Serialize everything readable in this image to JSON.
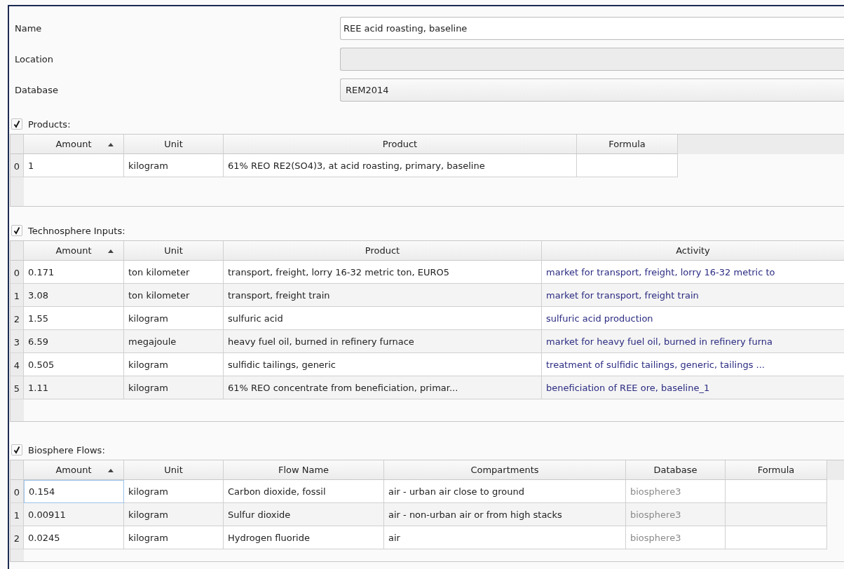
{
  "form": [
    {
      "label": "Name",
      "kind": "text",
      "value": "REE acid roasting, baseline",
      "disabled": false
    },
    {
      "label": "Location",
      "kind": "text",
      "disabled": true
    },
    {
      "label": "Database",
      "kind": "combo",
      "value": "REM2014",
      "disabled": false
    }
  ],
  "sections": [
    {
      "title": "Products:",
      "checked": true,
      "columns": [
        {
          "label": "Amount",
          "sorted_ascending": true,
          "kind": "text"
        },
        {
          "label": "Unit",
          "kind": "text"
        },
        {
          "label": "Product",
          "kind": "text"
        },
        {
          "label": "Formula",
          "kind": "text"
        }
      ],
      "rows": [
        {
          "header": "0",
          "current": false,
          "cells": [
            "1",
            "kilogram",
            "61% REO RE2(SO4)3, at acid roasting, primary, baseline",
            null
          ]
        }
      ]
    },
    {
      "title": "Technosphere Inputs:",
      "checked": true,
      "columns": [
        {
          "label": "Amount",
          "sorted_ascending": true,
          "kind": "text"
        },
        {
          "label": "Unit",
          "kind": "text"
        },
        {
          "label": "Product",
          "kind": "text"
        },
        {
          "label": "Activity",
          "kind": "link"
        }
      ],
      "rows": [
        {
          "header": "0",
          "current": false,
          "cells": [
            "0.171",
            "ton kilometer",
            "transport, freight, lorry 16-32 metric ton, EURO5",
            "market for transport, freight, lorry 16-32 metric to"
          ]
        },
        {
          "header": "1",
          "current": false,
          "cells": [
            "3.08",
            "ton kilometer",
            "transport, freight train",
            "market for transport, freight train"
          ]
        },
        {
          "header": "2",
          "current": false,
          "cells": [
            "1.55",
            "kilogram",
            "sulfuric acid",
            "sulfuric acid production"
          ]
        },
        {
          "header": "3",
          "current": false,
          "cells": [
            "6.59",
            "megajoule",
            "heavy fuel oil, burned in refinery furnace",
            "market for heavy fuel oil, burned in refinery furna"
          ]
        },
        {
          "header": "4",
          "current": false,
          "cells": [
            "0.505",
            "kilogram",
            "sulfidic tailings, generic",
            "treatment of sulfidic tailings, generic, tailings ..."
          ]
        },
        {
          "header": "5",
          "current": false,
          "cells": [
            "1.11",
            "kilogram",
            "61% REO concentrate from beneficiation, primar...",
            "beneficiation of REE ore, baseline_1"
          ]
        }
      ]
    },
    {
      "title": "Biosphere Flows:",
      "checked": true,
      "columns": [
        {
          "label": "Amount",
          "sorted_ascending": true,
          "kind": "text"
        },
        {
          "label": "Unit",
          "kind": "text"
        },
        {
          "label": "Flow Name",
          "kind": "text"
        },
        {
          "label": "Compartments",
          "kind": "text"
        },
        {
          "label": "Database",
          "kind": "muted"
        },
        {
          "label": "Formula",
          "kind": "text"
        }
      ],
      "rows": [
        {
          "header": "0",
          "current": true,
          "cells": [
            "0.154",
            "kilogram",
            "Carbon dioxide, fossil",
            "air - urban air close to ground",
            "biosphere3",
            null
          ]
        },
        {
          "header": "1",
          "current": false,
          "cells": [
            "0.00911",
            "kilogram",
            "Sulfur dioxide",
            "air - non-urban air or from high stacks",
            "biosphere3",
            null
          ]
        },
        {
          "header": "2",
          "current": false,
          "cells": [
            "0.0245",
            "kilogram",
            "Hydrogen fluoride",
            "air",
            "biosphere3",
            null
          ]
        }
      ]
    }
  ]
}
